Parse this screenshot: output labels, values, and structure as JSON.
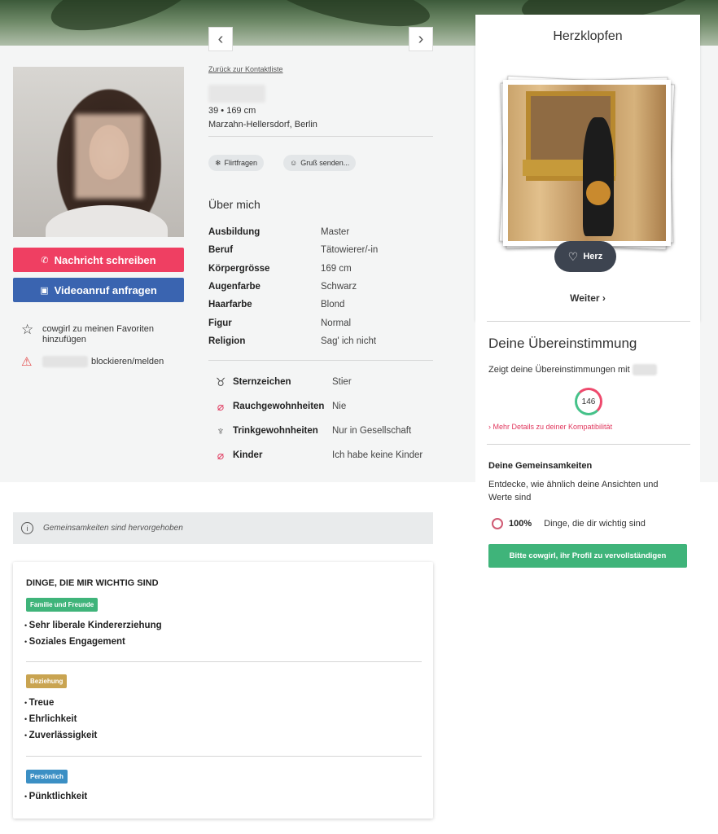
{
  "nav": {
    "prev_icon": "chevron-left-icon",
    "next_icon": "chevron-right-icon",
    "back_link": "Zurück zur Kontaktliste"
  },
  "profile": {
    "age_height": "39 • 169 cm",
    "location": "Marzahn-Hellersdorf, Berlin",
    "chips": [
      {
        "label": "Flirtfragen",
        "icon": "snowflake-icon"
      },
      {
        "label": "Gruß senden...",
        "icon": "smiley-icon"
      }
    ],
    "about_title": "Über mich",
    "attributes": [
      {
        "key": "Ausbildung",
        "value": "Master"
      },
      {
        "key": "Beruf",
        "value": "Tätowierer/-in"
      },
      {
        "key": "Körpergrösse",
        "value": "169 cm"
      },
      {
        "key": "Augenfarbe",
        "value": "Schwarz"
      },
      {
        "key": "Haarfarbe",
        "value": "Blond"
      },
      {
        "key": "Figur",
        "value": "Normal"
      },
      {
        "key": "Religion",
        "value": "Sag' ich nicht"
      }
    ],
    "lifestyle": [
      {
        "key": "Sternzeichen",
        "value": "Stier",
        "icon": "taurus-icon"
      },
      {
        "key": "Rauchgewohnheiten",
        "value": "Nie",
        "icon": "no-smoking-icon"
      },
      {
        "key": "Trinkgewohnheiten",
        "value": "Nur in Gesellschaft",
        "icon": "glass-icon"
      },
      {
        "key": "Kinder",
        "value": "Ich habe keine Kinder",
        "icon": "no-children-icon"
      }
    ]
  },
  "actions": {
    "message": "Nachricht schreiben",
    "video": "Videoanruf anfragen",
    "favorite": "cowgirl zu meinen Favoriten hinzufügen",
    "block": "blockieren/melden"
  },
  "info_bar": "Gemeinsamkeiten sind hervorgehoben",
  "values": {
    "title": "DINGE, DIE MIR WICHTIG SIND",
    "groups": [
      {
        "tag": "Familie und Freunde",
        "color": "#3fb47a",
        "items": [
          "Sehr liberale Kindererziehung",
          "Soziales Engagement"
        ]
      },
      {
        "tag": "Beziehung",
        "color": "#c9a451",
        "items": [
          "Treue",
          "Ehrlichkeit",
          "Zuverlässigkeit"
        ]
      },
      {
        "tag": "Persönlich",
        "color": "#3b8fc4",
        "items": [
          "Pünktlichkeit"
        ]
      }
    ]
  },
  "herzklopfen": {
    "title": "Herzklopfen",
    "herz_label": "Herz",
    "weiter": "Weiter ›"
  },
  "match": {
    "title": "Deine Übereinstimmung",
    "desc": "Zeigt deine Übereinstimmungen mit",
    "score": "146",
    "more": "› Mehr Details zu deiner Kompatibilität",
    "gem_title": "Deine Gemeinsamkeiten",
    "gem_desc": "Entdecke, wie ähnlich deine Ansichten und Werte sind",
    "gem_pct": "100%",
    "gem_label": "Dinge, die dir wichtig sind",
    "complete_btn": "Bitte cowgirl, ihr Profil zu vervollständigen"
  },
  "colors": {
    "accent_pink": "#ef3f62",
    "video_blue": "#3a64b0",
    "green": "#3fb47a"
  }
}
